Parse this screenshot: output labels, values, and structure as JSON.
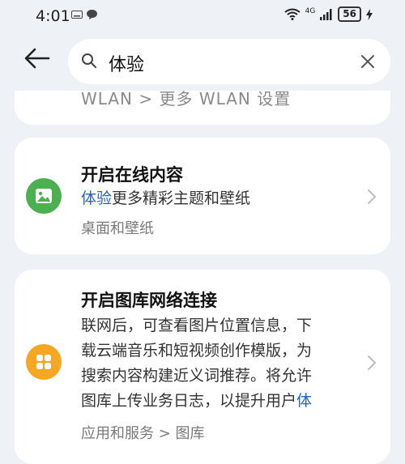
{
  "status": {
    "time": "4:01",
    "network": "4G",
    "battery": "56"
  },
  "search": {
    "query": "体验",
    "back_label": "",
    "clear_label": ""
  },
  "partial_result": {
    "text": "WLAN > 更多 WLAN 设置"
  },
  "results": [
    {
      "title": "开启在线内容",
      "desc_highlight": "体验",
      "desc_rest": "更多精彩主题和壁纸",
      "path": "桌面和壁纸",
      "icon": "image-icon",
      "icon_color": "#4caf50"
    },
    {
      "title": "开启图库网络连接",
      "desc_lines": [
        "联网后，可查看图片位置信息，下",
        "载云端音乐和短视频创作模版，为",
        "搜索内容构建近义词推荐。将允许"
      ],
      "desc_last_pre": "图库上传业务日志，以提升用户",
      "desc_last_hl": "体",
      "path": "应用和服务 > 图库",
      "icon": "gallery-icon",
      "icon_color": "#f5a623"
    }
  ],
  "colors": {
    "highlight": "#2a62c4",
    "background": "#eef1f5"
  }
}
